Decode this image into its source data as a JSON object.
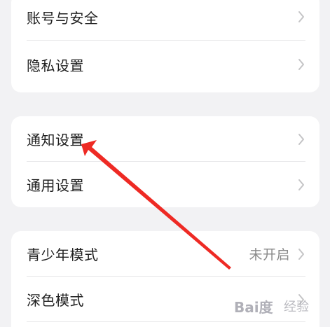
{
  "colors": {
    "background": "#f2f2f4",
    "card": "#ffffff",
    "text_primary": "#1f1f1f",
    "text_secondary": "#8a8a8a",
    "chevron": "#c4c4c6",
    "divider": "#e7e7e9",
    "annotation_arrow": "#ee2a24"
  },
  "groups": [
    {
      "items": [
        {
          "label": "账号与安全",
          "icon": "chevron-right-icon"
        },
        {
          "label": "隐私设置",
          "icon": "chevron-right-icon"
        }
      ]
    },
    {
      "items": [
        {
          "label": "通知设置",
          "icon": "chevron-right-icon"
        },
        {
          "label": "通用设置",
          "icon": "chevron-right-icon"
        }
      ]
    },
    {
      "items": [
        {
          "label": "青少年模式",
          "value": "未开启",
          "icon": "chevron-right-icon"
        },
        {
          "label": "深色模式",
          "icon": "chevron-right-icon"
        }
      ]
    }
  ],
  "watermark": {
    "brand": "Bai度",
    "suffix": "经验"
  }
}
